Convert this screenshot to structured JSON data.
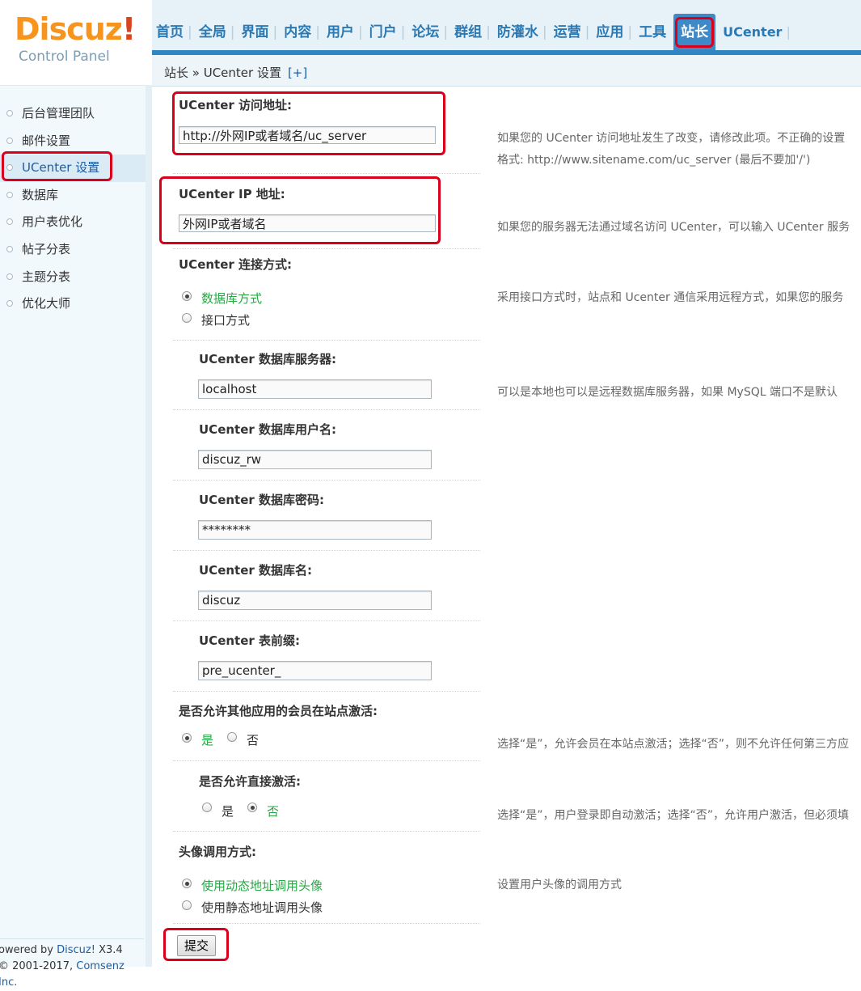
{
  "logo": {
    "brand": "Discuz",
    "bang": "!",
    "subtitle": "Control Panel"
  },
  "nav": {
    "items": [
      "首页",
      "全局",
      "界面",
      "内容",
      "用户",
      "门户",
      "论坛",
      "群组",
      "防灌水",
      "运营",
      "应用",
      "工具",
      "站长",
      "UCenter"
    ],
    "active": "站长"
  },
  "breadcrumb": {
    "path": "站长 » UCenter 设置",
    "plus": "[+]"
  },
  "sidebar": {
    "items": [
      "后台管理团队",
      "邮件设置",
      "UCenter 设置",
      "数据库",
      "用户表优化",
      "帖子分表",
      "主题分表",
      "优化大师"
    ],
    "active_index": 2
  },
  "footer": {
    "powered_prefix": "owered by ",
    "powered_brand": "Discuz!",
    "powered_version": " X3.4",
    "copyright_prefix": "© 2001-2017, ",
    "copyright_company": "Comsenz Inc."
  },
  "form": {
    "uc_api": {
      "label": "UCenter 访问地址:",
      "value": "http://外网IP或者域名/uc_server",
      "tip_line1": "如果您的 UCenter 访问地址发生了改变，请修改此项。不正确的设置",
      "tip_line2": "格式: http://www.sitename.com/uc_server (最后不要加'/')"
    },
    "uc_ip": {
      "label": "UCenter IP 地址:",
      "value": "外网IP或者域名",
      "tip": "如果您的服务器无法通过域名访问 UCenter，可以输入 UCenter 服务"
    },
    "uc_connect": {
      "label": "UCenter 连接方式:",
      "option_db": "数据库方式",
      "option_api": "接口方式",
      "selected": "数据库方式",
      "tip": "采用接口方式时，站点和 Ucenter 通信采用远程方式，如果您的服务"
    },
    "db_host": {
      "label": "UCenter 数据库服务器:",
      "value": "localhost",
      "tip": "可以是本地也可以是远程数据库服务器，如果 MySQL 端口不是默认"
    },
    "db_user": {
      "label": "UCenter 数据库用户名:",
      "value": "discuz_rw"
    },
    "db_pass": {
      "label": "UCenter 数据库密码:",
      "value": "********"
    },
    "db_name": {
      "label": "UCenter 数据库名:",
      "value": "discuz"
    },
    "db_prefix": {
      "label": "UCenter 表前缀:",
      "value": "pre_ucenter_"
    },
    "allow_activate": {
      "label": "是否允许其他应用的会员在站点激活:",
      "yes": "是",
      "no": "否",
      "selected": "是",
      "tip": "选择“是”，允许会员在本站点激活；选择“否”，则不允许任何第三方应"
    },
    "direct_activate": {
      "label": "是否允许直接激活:",
      "yes": "是",
      "no": "否",
      "selected": "否",
      "tip": "选择“是”，用户登录即自动激活；选择“否”，允许用户激活，但必须填"
    },
    "avatar": {
      "label": "头像调用方式:",
      "option_dynamic": "使用动态地址调用头像",
      "option_static": "使用静态地址调用头像",
      "selected": "使用动态地址调用头像",
      "tip": "设置用户头像的调用方式"
    },
    "submit_label": "提交"
  },
  "colors": {
    "nav_text": "#2b79b3",
    "nav_active_bg": "#3e89c7",
    "highlight_box": "#d9001b",
    "selected_option": "#28a745",
    "sidebar_bg": "#f2f9fd"
  }
}
